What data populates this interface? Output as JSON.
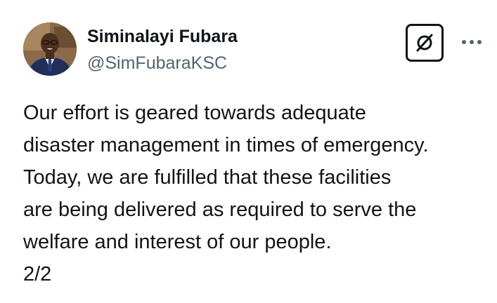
{
  "author": {
    "display_name": "Siminalayi Fubara",
    "handle": "@SimFubaraKSC"
  },
  "tweet": {
    "text": "Our effort is geared towards adequate\ndisaster management in times of emergency.\nToday, we are fulfilled that these facilities\nare being delivered as required to serve the\nwelfare and interest of our people.\n2/2"
  },
  "icons": {
    "grok": "grok-icon",
    "more": "more-horizontal-icon"
  },
  "colors": {
    "text_primary": "#0f1419",
    "text_secondary": "#536471",
    "background": "#ffffff"
  }
}
